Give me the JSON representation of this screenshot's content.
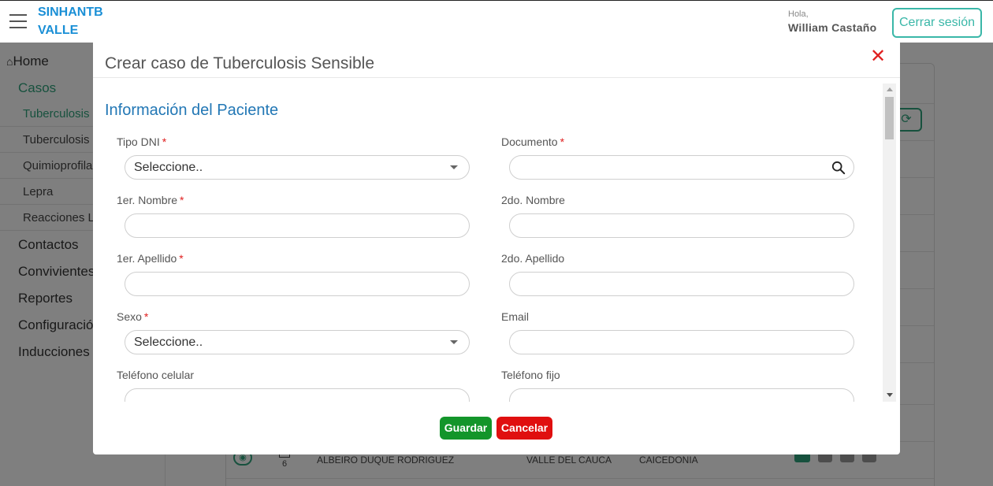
{
  "header": {
    "brand_line1": "SINHANTB",
    "brand_line2": "VALLE",
    "greeting": "Hola,",
    "user_name": "William Castaño",
    "logout_label": "Cerrar sesión"
  },
  "sidebar": {
    "home_label": "Home",
    "casos_label": "Casos",
    "subitems": [
      "Tuberculosis S",
      "Tuberculosis F",
      "Quimioprofilax",
      "Lepra",
      "Reacciones Le"
    ],
    "items": [
      "Contactos",
      "Convivientes",
      "Reportes",
      "Configuración",
      "Inducciones"
    ]
  },
  "background_row": {
    "number": "6",
    "name": "ALBEIRO DUQUE RODRIGUEZ",
    "department": "VALLE DEL CAUCA",
    "city": "CAICEDONIA"
  },
  "modal": {
    "title": "Crear caso de Tuberculosis Sensible",
    "section_title": "Información del Paciente",
    "fields": {
      "tipo_dni": {
        "label": "Tipo DNI",
        "required": "*",
        "value": "Seleccione.."
      },
      "documento": {
        "label": "Documento",
        "required": "*",
        "value": ""
      },
      "nombre1": {
        "label": "1er. Nombre",
        "required": "*",
        "value": ""
      },
      "nombre2": {
        "label": "2do. Nombre",
        "value": ""
      },
      "apellido1": {
        "label": "1er. Apellido",
        "required": "*",
        "value": ""
      },
      "apellido2": {
        "label": "2do. Apellido",
        "value": ""
      },
      "sexo": {
        "label": "Sexo",
        "required": "*",
        "value": "Seleccione.."
      },
      "email": {
        "label": "Email",
        "value": ""
      },
      "celular": {
        "label": "Teléfono celular",
        "value": ""
      },
      "fijo": {
        "label": "Teléfono fijo",
        "value": ""
      }
    },
    "save_label": "Guardar",
    "cancel_label": "Cancelar"
  },
  "colors": {
    "brand": "#1a8fd6",
    "accent": "#3ab7a8",
    "sidebar_active": "#2fa37c",
    "section_title": "#2277b5",
    "required": "#e02020",
    "save": "#13952a",
    "cancel": "#e00f0f"
  },
  "icons": {
    "menu": "hamburger-icon",
    "home": "home-icon",
    "close": "close-icon",
    "search": "search-icon",
    "dropdown": "chevron-down-icon",
    "refresh": "refresh-icon",
    "view": "eye-icon"
  }
}
